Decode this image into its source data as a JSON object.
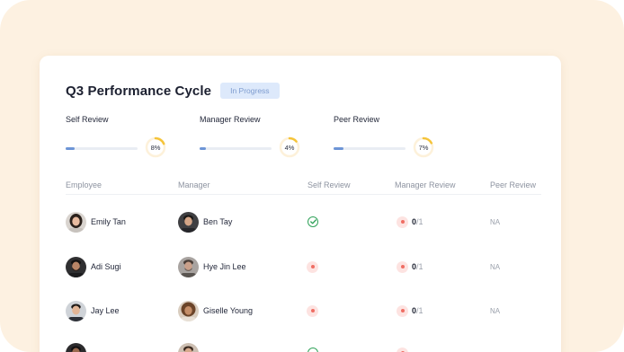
{
  "header": {
    "title": "Q3 Performance Cycle",
    "status_badge": "In Progress"
  },
  "progress": [
    {
      "label": "Self Review",
      "percent_text": "8%",
      "value": 0.08
    },
    {
      "label": "Manager Review",
      "percent_text": "4%",
      "value": 0.04
    },
    {
      "label": "Peer Review",
      "percent_text": "7%",
      "value": 0.07
    }
  ],
  "colors": {
    "accent": "#6d95d6",
    "ring": "#f5c43a",
    "pending": "#ef6d63",
    "completed": "#33a35b",
    "backdrop": "#fdf1e1"
  },
  "table": {
    "columns": [
      "Employee",
      "Manager",
      "Self Review",
      "Manager Review",
      "Peer Review"
    ],
    "rows": [
      {
        "employee": "Emily Tan",
        "employee_avatar": "woman-dark-hair",
        "manager": "Ben Tay",
        "manager_avatar": "man-dark-hair",
        "self_review": "completed",
        "manager_review_done": "0",
        "manager_review_total": "/1",
        "peer_review": "NA"
      },
      {
        "employee": "Adi Sugi",
        "employee_avatar": "man-beard",
        "manager": "Hye Jin Lee",
        "manager_avatar": "man-beard-grey",
        "self_review": "pending",
        "manager_review_done": "0",
        "manager_review_total": "/1",
        "peer_review": "NA"
      },
      {
        "employee": "Jay Lee",
        "employee_avatar": "man-short-hair",
        "manager": "Giselle Young",
        "manager_avatar": "woman-curly-hair",
        "self_review": "pending",
        "manager_review_done": "0",
        "manager_review_total": "/1",
        "peer_review": "NA"
      }
    ]
  }
}
